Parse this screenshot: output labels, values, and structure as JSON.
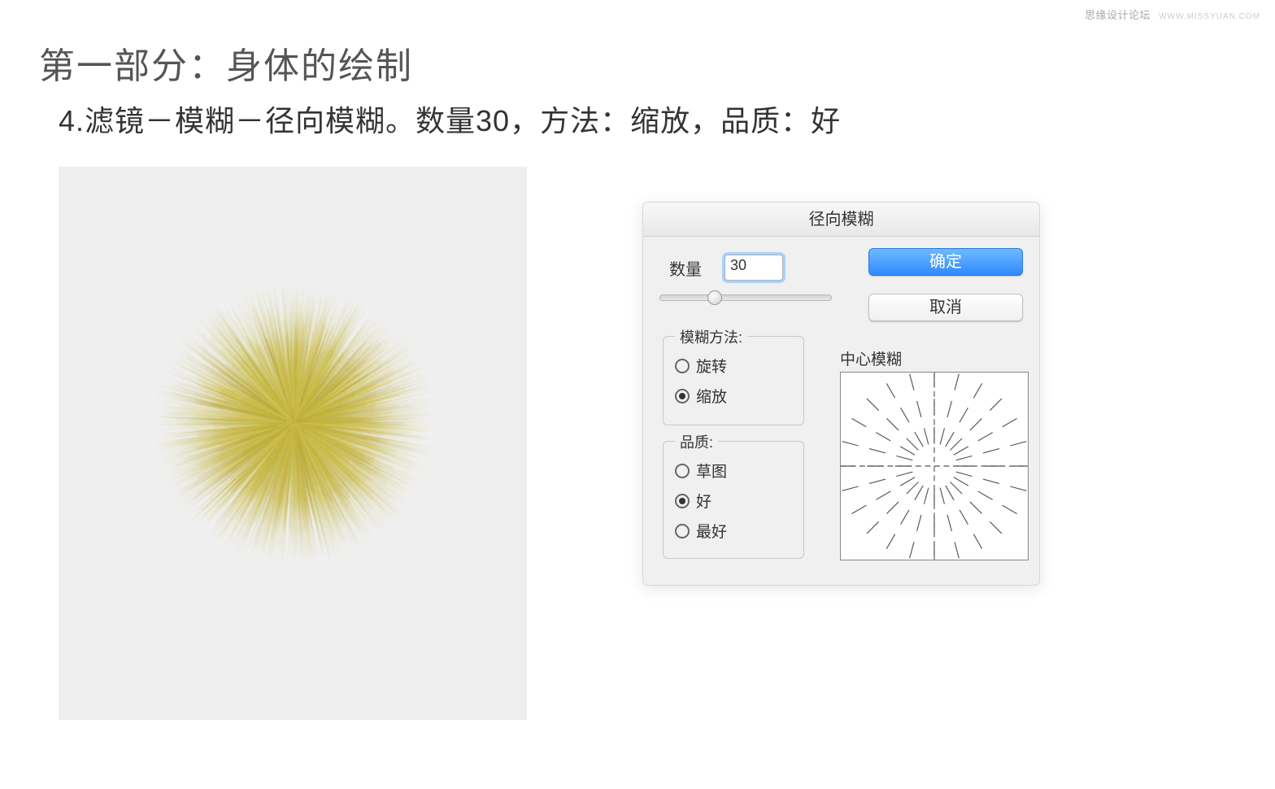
{
  "watermark": {
    "text": "思缘设计论坛",
    "site": "WWW.MISSYUAN.COM"
  },
  "page_title": "第一部分：身体的绘制",
  "instruction": "4.滤镜－模糊－径向模糊。数量30，方法：缩放，品质：好",
  "dialog": {
    "title": "径向模糊",
    "amount_label": "数量",
    "amount_value": "30",
    "ok_label": "确定",
    "cancel_label": "取消",
    "method": {
      "legend": "模糊方法:",
      "options": [
        {
          "label": "旋转",
          "checked": false
        },
        {
          "label": "缩放",
          "checked": true
        }
      ]
    },
    "quality": {
      "legend": "品质:",
      "options": [
        {
          "label": "草图",
          "checked": false
        },
        {
          "label": "好",
          "checked": true
        },
        {
          "label": "最好",
          "checked": false
        }
      ]
    },
    "center_blur_label": "中心模糊"
  }
}
